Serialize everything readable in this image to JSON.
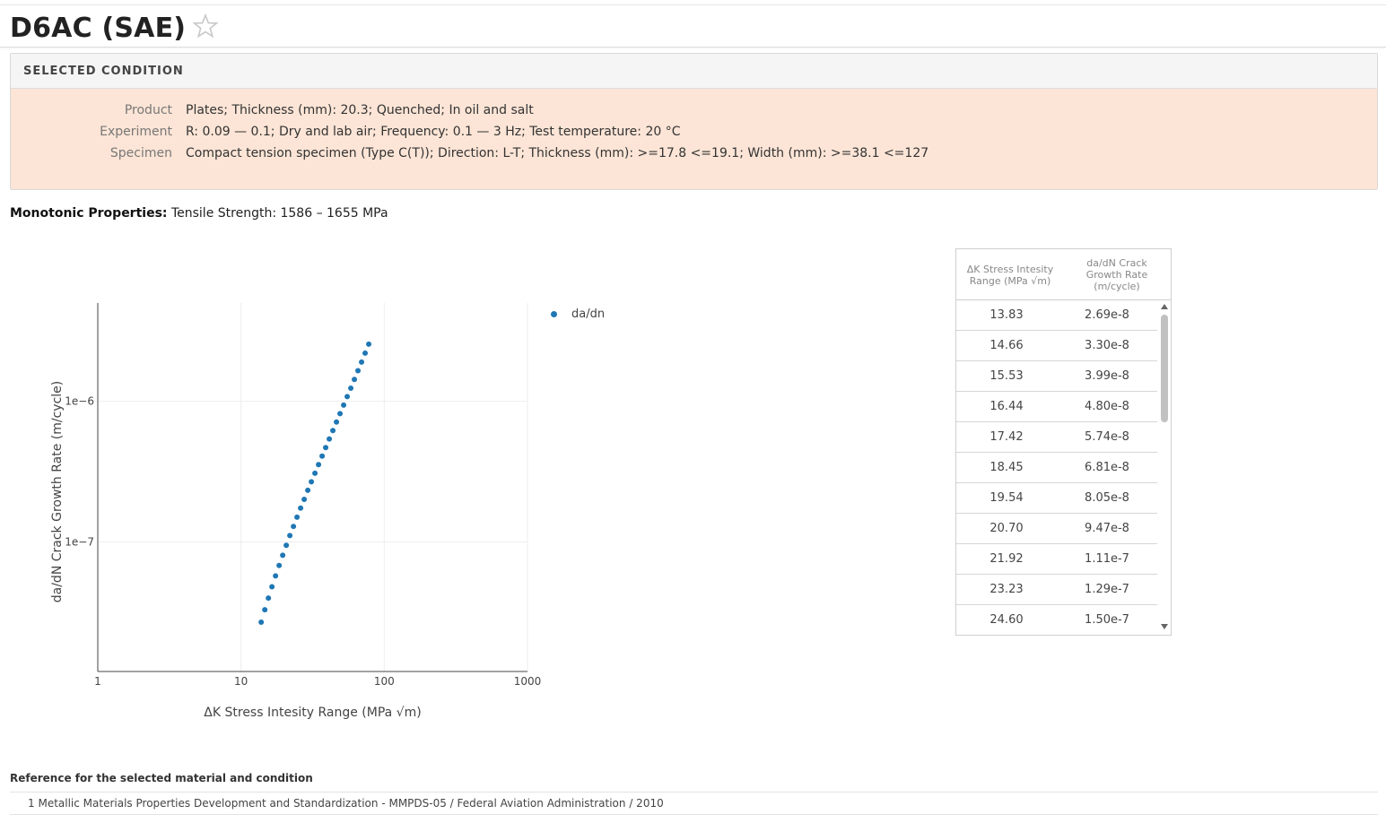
{
  "header": {
    "title": "D6AC (SAE)",
    "favorite_icon": "star-outline-icon"
  },
  "condition": {
    "heading": "SELECTED CONDITION",
    "rows": [
      {
        "label": "Product",
        "value": "Plates; Thickness (mm): 20.3; Quenched; In oil and salt"
      },
      {
        "label": "Experiment",
        "value": "R: 0.09 — 0.1; Dry and lab air; Frequency: 0.1 — 3 Hz; Test temperature: 20 °C"
      },
      {
        "label": "Specimen",
        "value": "Compact tension specimen (Type C(T)); Direction: L-T; Thickness (mm): >=17.8 <=19.1; Width (mm): >=38.1 <=127"
      }
    ]
  },
  "monotonic": {
    "label": "Monotonic Properties:",
    "value": "Tensile Strength: 1586 – 1655 MPa"
  },
  "chart_data": {
    "type": "scatter",
    "xlabel": "ΔK Stress Intesity Range (MPa √m)",
    "ylabel": "da/dN Crack Growth Rate (m/cycle)",
    "xscale": "log",
    "yscale": "log",
    "xlim": [
      1,
      1000
    ],
    "ylim": [
      1.2e-08,
      5e-06
    ],
    "x_ticks": [
      "1",
      "10",
      "100",
      "1000"
    ],
    "y_ticks": [
      "1e−7",
      "1e−6"
    ],
    "grid": true,
    "legend_position": "right",
    "series": [
      {
        "name": "da/dn",
        "color": "#1f77b4",
        "x": [
          13.83,
          14.66,
          15.53,
          16.44,
          17.42,
          18.45,
          19.54,
          20.7,
          21.92,
          23.23,
          24.6,
          26.06,
          27.61,
          29.25,
          30.98,
          32.82,
          34.77,
          36.83,
          39.01,
          41.33,
          43.78,
          46.38,
          49.13,
          52.05,
          55.13,
          58.41,
          61.87,
          65.54,
          69.43,
          73.55,
          77.92
        ],
        "y": [
          2.69e-08,
          3.3e-08,
          3.99e-08,
          4.8e-08,
          5.74e-08,
          6.81e-08,
          8.05e-08,
          9.47e-08,
          1.11e-07,
          1.29e-07,
          1.5e-07,
          1.74e-07,
          2.01e-07,
          2.33e-07,
          2.68e-07,
          3.08e-07,
          3.55e-07,
          4.08e-07,
          4.69e-07,
          5.4e-07,
          6.2e-07,
          7.12e-07,
          8.18e-07,
          9.4e-07,
          1.08e-06,
          1.24e-06,
          1.43e-06,
          1.65e-06,
          1.9e-06,
          2.2e-06,
          2.55e-06
        ]
      }
    ]
  },
  "table": {
    "headers": [
      "ΔK Stress Intesity Range (MPa √m)",
      "da/dN Crack Growth Rate (m/cycle)"
    ],
    "rows": [
      [
        "13.83",
        "2.69e-8"
      ],
      [
        "14.66",
        "3.30e-8"
      ],
      [
        "15.53",
        "3.99e-8"
      ],
      [
        "16.44",
        "4.80e-8"
      ],
      [
        "17.42",
        "5.74e-8"
      ],
      [
        "18.45",
        "6.81e-8"
      ],
      [
        "19.54",
        "8.05e-8"
      ],
      [
        "20.70",
        "9.47e-8"
      ],
      [
        "21.92",
        "1.11e-7"
      ],
      [
        "23.23",
        "1.29e-7"
      ],
      [
        "24.60",
        "1.50e-7"
      ]
    ]
  },
  "reference": {
    "title": "Reference for the selected material and condition",
    "items": [
      {
        "num": "1",
        "text": "Metallic Materials Properties Development and Standardization - MMPDS-05 / Federal Aviation Administration / 2010"
      }
    ]
  }
}
